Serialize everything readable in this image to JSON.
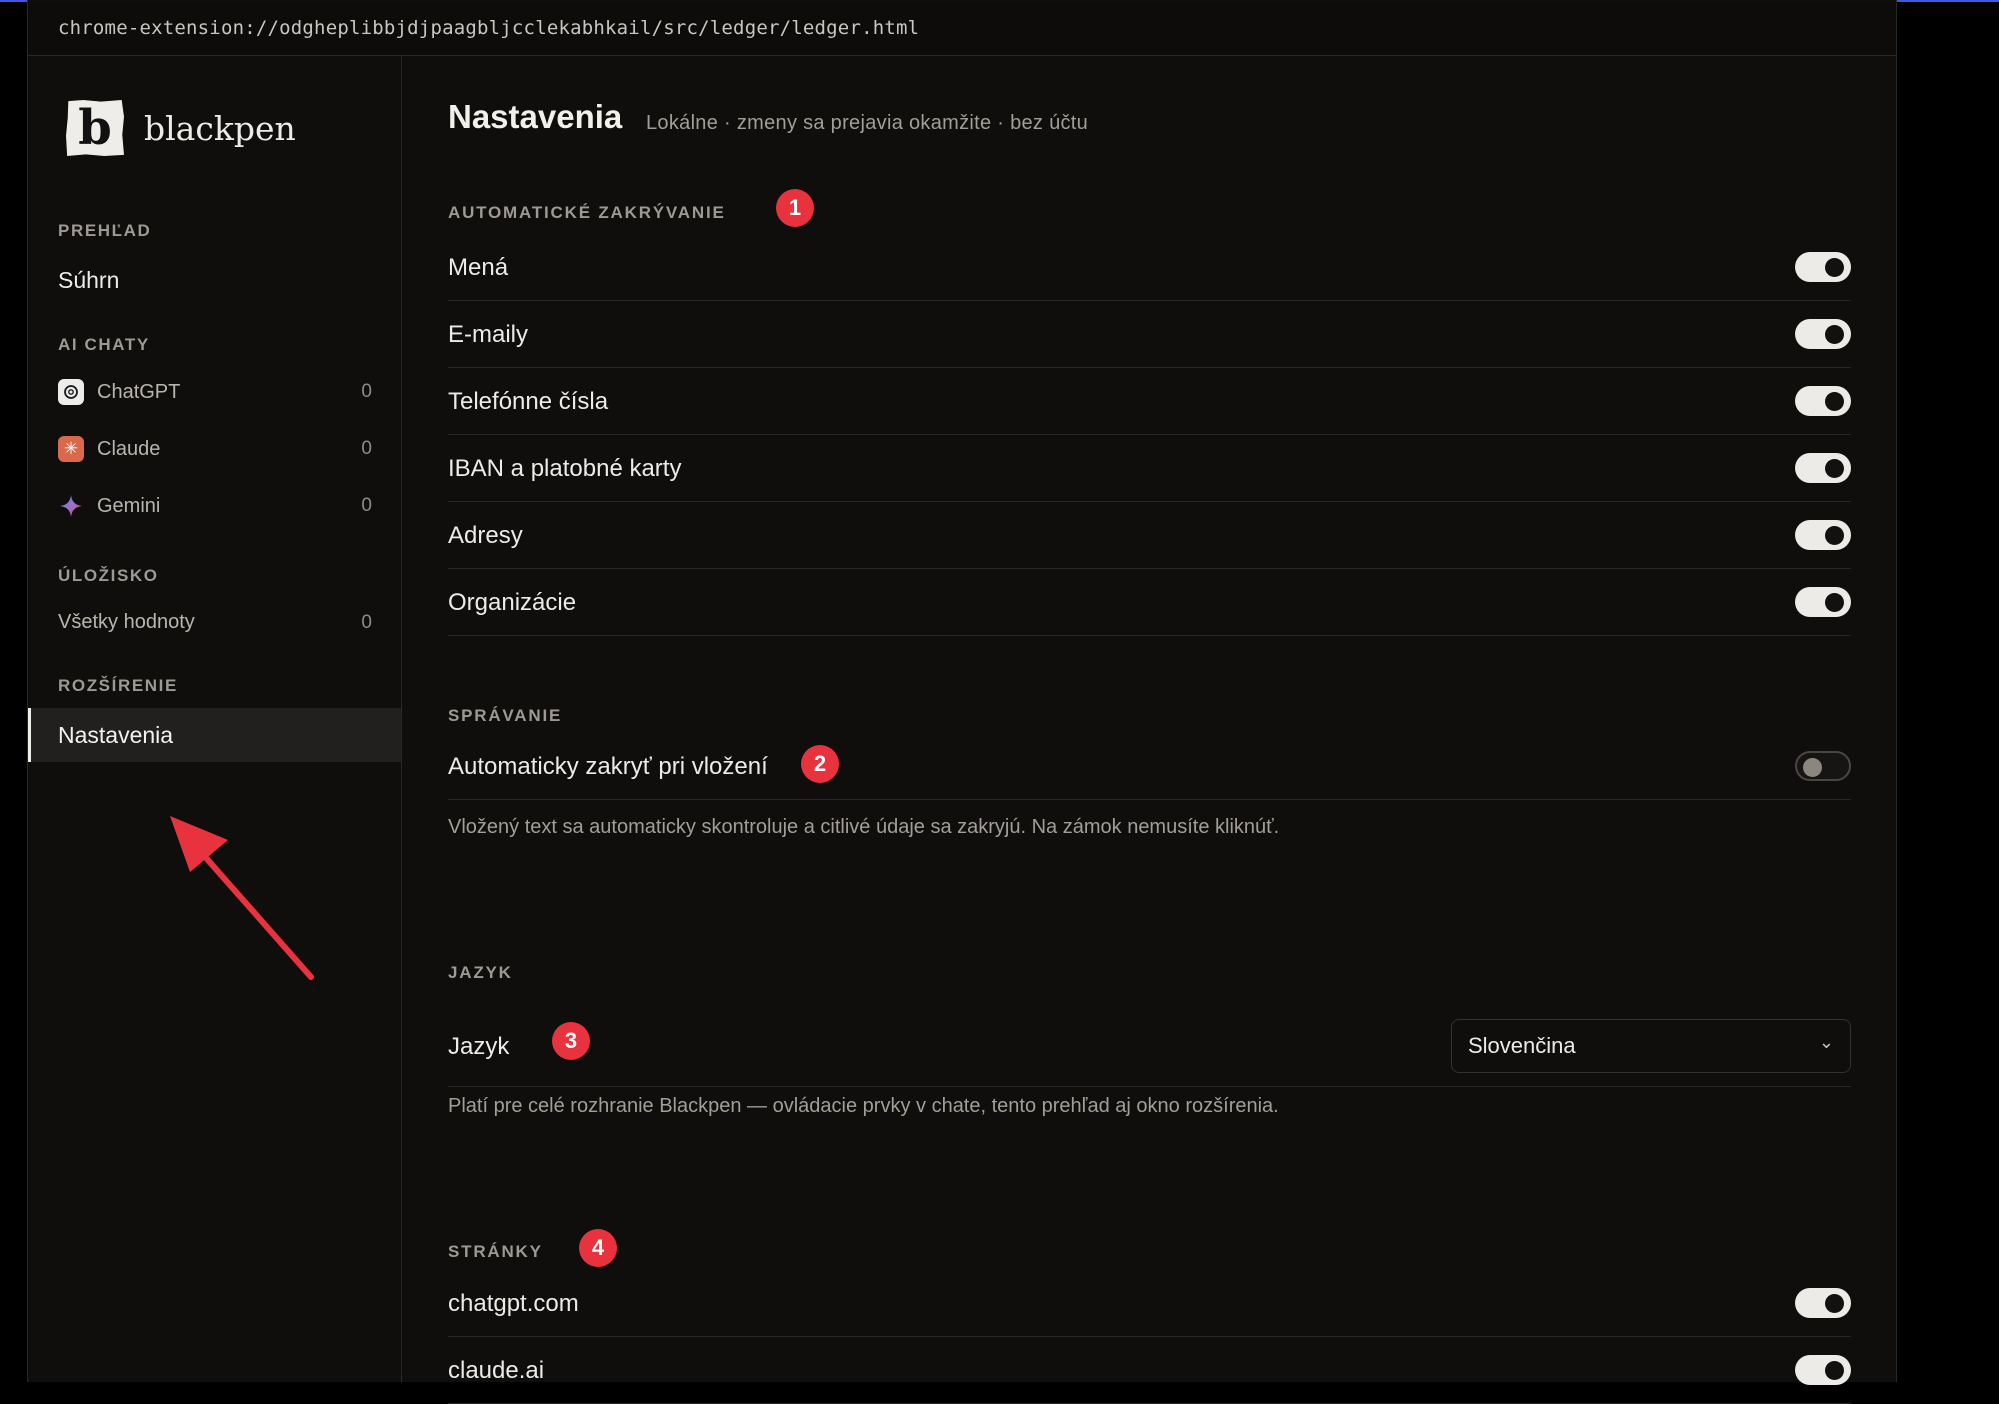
{
  "url": "chrome-extension://odgheplibbjdjpaagbljcclekabhkail/src/ledger/ledger.html",
  "brand": {
    "mark": "b",
    "name": "blackpen"
  },
  "sidebar": {
    "sections": [
      {
        "title": "PREHĽAD"
      },
      {
        "title": "AI CHATY"
      },
      {
        "title": "ÚLOŽISKO"
      },
      {
        "title": "ROZŠÍRENIE"
      }
    ],
    "summary": "Súhrn",
    "chats": [
      {
        "label": "ChatGPT",
        "count": "0",
        "icon": "chatgpt-icon"
      },
      {
        "label": "Claude",
        "count": "0",
        "icon": "claude-icon"
      },
      {
        "label": "Gemini",
        "count": "0",
        "icon": "gemini-icon"
      }
    ],
    "all_values": {
      "label": "Všetky hodnoty",
      "count": "0"
    },
    "active_item": "Nastavenia"
  },
  "main": {
    "title": "Nastavenia",
    "subtitle": "Lokálne · zmeny sa prejavia okamžite · bez účtu",
    "auto_redact": {
      "title": "AUTOMATICKÉ ZAKRÝVANIE",
      "badge": "1",
      "items": [
        {
          "label": "Mená",
          "on": true
        },
        {
          "label": "E-maily",
          "on": true
        },
        {
          "label": "Telefónne čísla",
          "on": true
        },
        {
          "label": "IBAN a platobné karty",
          "on": true
        },
        {
          "label": "Adresy",
          "on": true
        },
        {
          "label": "Organizácie",
          "on": true
        }
      ]
    },
    "behavior": {
      "title": "SPRÁVANIE",
      "item": {
        "label": "Automaticky zakryť pri vložení",
        "on": false
      },
      "badge": "2",
      "description": "Vložený text sa automaticky skontroluje a citlivé údaje sa zakryjú. Na zámok nemusíte kliknúť."
    },
    "language": {
      "title": "JAZYK",
      "label": "Jazyk",
      "badge": "3",
      "selected": "Slovenčina",
      "description": "Platí pre celé rozhranie Blackpen — ovládacie prvky v chate, tento prehľad aj okno rozšírenia."
    },
    "pages": {
      "title": "STRÁNKY",
      "badge": "4",
      "items": [
        {
          "label": "chatgpt.com",
          "on": true
        },
        {
          "label": "claude.ai",
          "on": true
        }
      ]
    }
  },
  "colors": {
    "accent_badge": "#e8323d",
    "background": "#0f0e0d",
    "toggle_on": "#ecebe8"
  }
}
